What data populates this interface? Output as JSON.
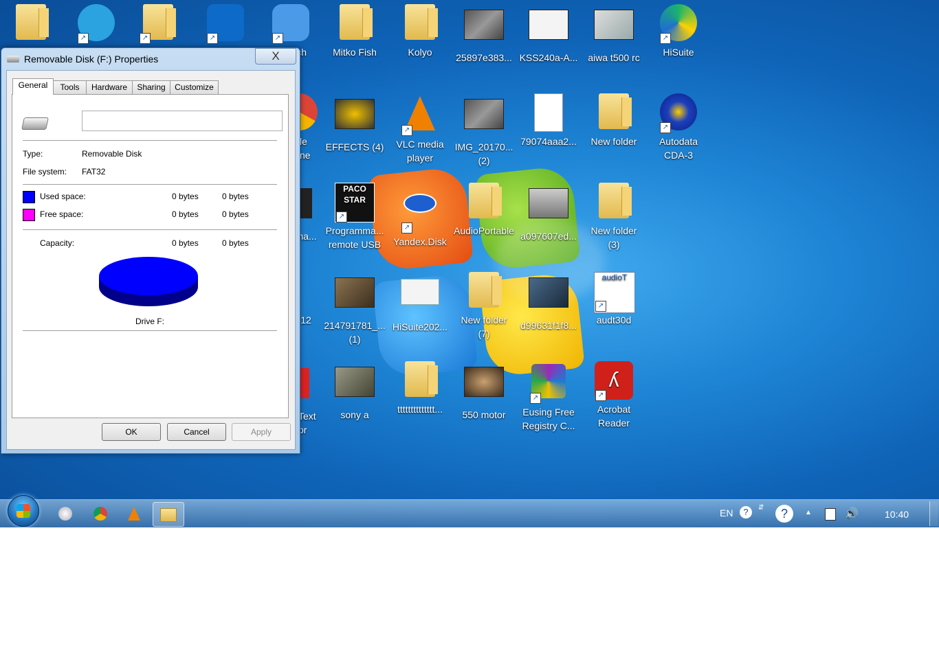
{
  "dialog": {
    "title": "Removable Disk (F:) Properties",
    "close_glyph": "X",
    "tabs": [
      {
        "label": "General",
        "active": true
      },
      {
        "label": "Tools"
      },
      {
        "label": "Hardware"
      },
      {
        "label": "Sharing"
      },
      {
        "label": "Customize"
      }
    ],
    "name_value": "",
    "type_label": "Type:",
    "type_value": "Removable Disk",
    "fs_label": "File system:",
    "fs_value": "FAT32",
    "used_label": "Used space:",
    "used_bytes": "0 bytes",
    "used_size": "0 bytes",
    "free_label": "Free space:",
    "free_bytes": "0 bytes",
    "free_size": "0 bytes",
    "capacity_label": "Capacity:",
    "capacity_bytes": "0 bytes",
    "capacity_size": "0 bytes",
    "drive_label": "Drive F:",
    "ok_label": "OK",
    "cancel_label": "Cancel",
    "apply_label": "Apply",
    "used_color": "#0000ff",
    "free_color": "#ff00ff"
  },
  "desktop": {
    "icons": [
      {
        "label": "",
        "icon": "user-folder-icon"
      },
      {
        "label": "",
        "icon": "telegram-icon"
      },
      {
        "label": "",
        "icon": "folder-icon"
      },
      {
        "label": "",
        "icon": "teamviewer-icon"
      },
      {
        "label": "witch",
        "icon": "skype-icon"
      },
      {
        "label": "Mitko Fish",
        "icon": "folder-icon"
      },
      {
        "label": "Kolyo",
        "icon": "folder-icon"
      },
      {
        "label": "25897e383...",
        "icon": "image-thumbnail-icon"
      },
      {
        "label": "KSS240a-A...",
        "icon": "schematic-thumbnail-icon"
      },
      {
        "label": "aiwa t500 rc",
        "icon": "image-thumbnail-icon"
      },
      {
        "label": "HiSuite",
        "icon": "hisuite-icon"
      },
      {
        "label": "le\nne",
        "icon": "chrome-icon"
      },
      {
        "label": "EFFECTS (4)",
        "icon": "image-thumbnail-icon"
      },
      {
        "label": "VLC media\nplayer",
        "icon": "vlc-icon"
      },
      {
        "label": "IMG_20170...\n(2)",
        "icon": "image-thumbnail-icon"
      },
      {
        "label": "79074aaa2...",
        "icon": "document-icon"
      },
      {
        "label": "New folder",
        "icon": "folder-icon"
      },
      {
        "label": "Autodata\nCDA-3",
        "icon": "autodata-icon"
      },
      {
        "label": "ma...",
        "icon": "image-thumbnail-icon"
      },
      {
        "label": "Programma...\nremote USB",
        "icon": "pacostar-icon"
      },
      {
        "label": "Yandex.Disk",
        "icon": "yandex-disk-icon"
      },
      {
        "label": "AudioPortable",
        "icon": "folder-icon"
      },
      {
        "label": "a097607ed...",
        "icon": "image-thumbnail-icon"
      },
      {
        "label": "New folder\n(3)",
        "icon": "folder-icon"
      },
      {
        "label": "12",
        "icon": "image-thumbnail-icon"
      },
      {
        "label": "214791781_...\n(1)",
        "icon": "image-thumbnail-icon"
      },
      {
        "label": "HiSuite202...",
        "icon": "contact-card-icon"
      },
      {
        "label": "New folder\n(7)",
        "icon": "folder-icon"
      },
      {
        "label": "d99631f1f8...",
        "icon": "image-thumbnail-icon"
      },
      {
        "label": "audt30d",
        "icon": "audiot-icon"
      },
      {
        "label": "Text\nor",
        "icon": "text-editor-icon"
      },
      {
        "label": "sony a",
        "icon": "image-thumbnail-icon"
      },
      {
        "label": "tttttttttttttt...",
        "icon": "folder-icon"
      },
      {
        "label": "550 motor",
        "icon": "image-thumbnail-icon"
      },
      {
        "label": "Eusing Free\nRegistry C...",
        "icon": "registry-cleaner-icon"
      },
      {
        "label": "Acrobat\nReader",
        "icon": "acrobat-icon"
      }
    ]
  },
  "taskbar": {
    "pinned": [
      "globe-icon",
      "chrome-icon",
      "vlc-icon",
      "explorer-icon"
    ],
    "lang": "EN",
    "clock": "10:40"
  }
}
